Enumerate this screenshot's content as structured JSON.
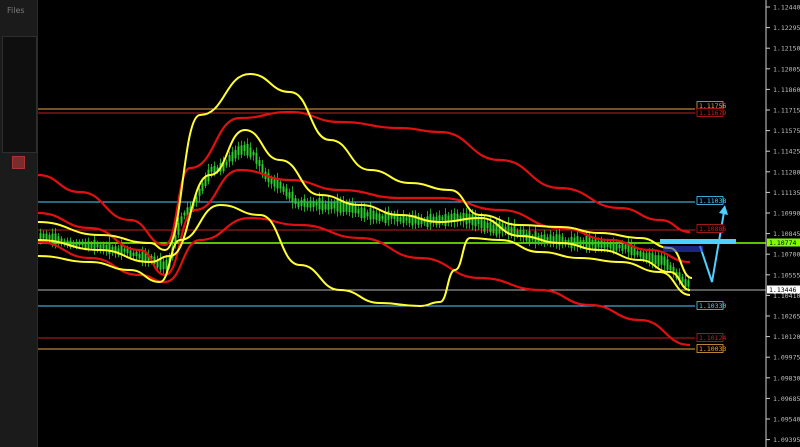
{
  "app": {
    "panel_label": "Files"
  },
  "colors": {
    "background": "#000000",
    "axis_text": "#bfbfbf",
    "band_yellow": "#ffff33",
    "band_red": "#e01010",
    "candles": "#2ecc2e",
    "level_green": "#7fff00",
    "level_cyan": "#4fd0ff",
    "level_orange": "#e8a640",
    "level_red": "#c02020"
  },
  "chart_data": {
    "type": "candlestick",
    "y_axis_ticks": [
      "1.12440",
      "1.12295",
      "1.12150",
      "1.12005",
      "1.11860",
      "1.11715",
      "1.11575",
      "1.11425",
      "1.11280",
      "1.11135",
      "1.10990",
      "1.10845",
      "1.10700",
      "1.10555",
      "1.10410",
      "1.10265",
      "1.10120",
      "1.09975",
      "1.09830",
      "1.09685",
      "1.09540",
      "1.09395"
    ],
    "levels": [
      {
        "label": "1.11756",
        "color": "#e8a640"
      },
      {
        "label": "1.11679",
        "color": "#c02020"
      },
      {
        "label": "1.11038",
        "color": "#4fd0ff"
      },
      {
        "label": "1.10886",
        "color": "#c02020"
      },
      {
        "label": "1.10774",
        "color": "#7fff00",
        "current": true
      },
      {
        "label": "1.13446",
        "color": "#ffffff"
      },
      {
        "label": "1.10330",
        "color": "#4fd0ff"
      },
      {
        "label": "1.10124",
        "color": "#c02020"
      },
      {
        "label": "1.10033",
        "color": "#e8a640"
      }
    ],
    "projection": {
      "shape": "V-arrow",
      "color": "#4fd0ff"
    },
    "indicators": [
      "bollinger-bands-yellow",
      "envelope-bands-red"
    ]
  }
}
